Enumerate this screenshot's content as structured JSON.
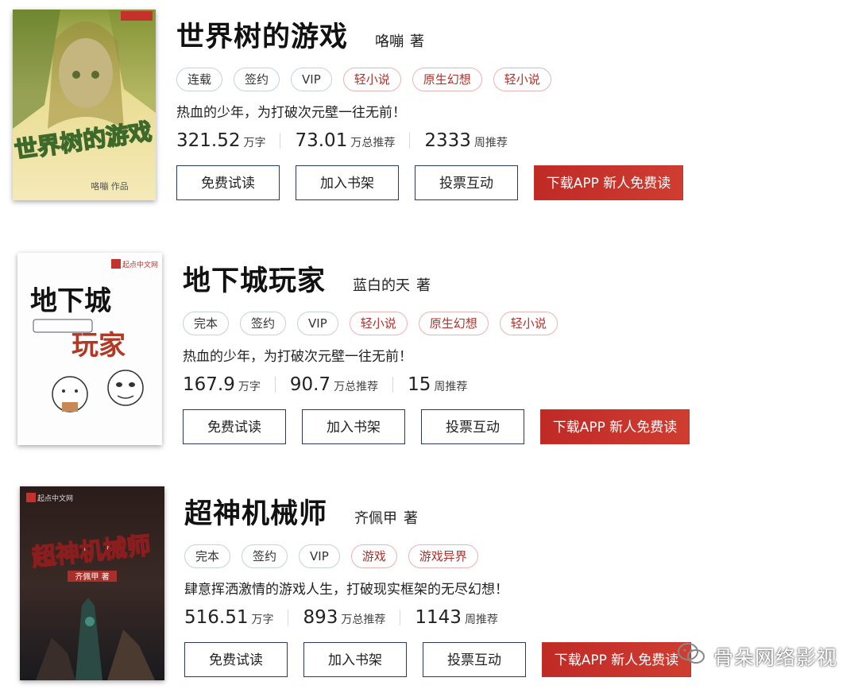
{
  "books": [
    {
      "title": "世界树的游戏",
      "author": "咯嘣",
      "author_suffix": "著",
      "cover_text": "世界树的游戏",
      "cover_author": "咯嘣 作品",
      "tags": [
        {
          "label": "连载",
          "accent": false
        },
        {
          "label": "签约",
          "accent": false
        },
        {
          "label": "VIP",
          "accent": false
        },
        {
          "label": "轻小说",
          "accent": true
        },
        {
          "label": "原生幻想",
          "accent": true
        },
        {
          "label": "轻小说",
          "accent": true
        }
      ],
      "intro": "热血的少年，为打破次元壁一往无前！",
      "stats": [
        {
          "value": "321.52",
          "unit": "万字"
        },
        {
          "value": "73.01",
          "unit": "万总推荐"
        },
        {
          "value": "2333",
          "unit": "周推荐"
        }
      ],
      "buttons": {
        "trial": "免费试读",
        "shelf": "加入书架",
        "vote": "投票互动",
        "download": "下载APP 新人免费读"
      }
    },
    {
      "title": "地下城玩家",
      "author": "蓝白的天",
      "author_suffix": "著",
      "cover_logo": "起点中文网",
      "cover_line1": "地下城",
      "cover_line2": "玩家",
      "tags": [
        {
          "label": "完本",
          "accent": false
        },
        {
          "label": "签约",
          "accent": false
        },
        {
          "label": "VIP",
          "accent": false
        },
        {
          "label": "轻小说",
          "accent": true
        },
        {
          "label": "原生幻想",
          "accent": true
        },
        {
          "label": "轻小说",
          "accent": true
        }
      ],
      "intro": "热血的少年，为打破次元壁一往无前！",
      "stats": [
        {
          "value": "167.9",
          "unit": "万字"
        },
        {
          "value": "90.7",
          "unit": "万总推荐"
        },
        {
          "value": "15",
          "unit": "周推荐"
        }
      ],
      "buttons": {
        "trial": "免费试读",
        "shelf": "加入书架",
        "vote": "投票互动",
        "download": "下载APP 新人免费读"
      }
    },
    {
      "title": "超神机械师",
      "author": "齐佩甲",
      "author_suffix": "著",
      "cover_logo": "起点中文网",
      "cover_text": "超神机械师",
      "cover_author": "齐佩甲 著",
      "tags": [
        {
          "label": "完本",
          "accent": false
        },
        {
          "label": "签约",
          "accent": false
        },
        {
          "label": "VIP",
          "accent": false
        },
        {
          "label": "游戏",
          "accent": true
        },
        {
          "label": "游戏异界",
          "accent": true
        }
      ],
      "intro": "肆意挥洒激情的游戏人生，打破现实框架的无尽幻想！",
      "stats": [
        {
          "value": "516.51",
          "unit": "万字"
        },
        {
          "value": "893",
          "unit": "万总推荐"
        },
        {
          "value": "1143",
          "unit": "周推荐"
        }
      ],
      "buttons": {
        "trial": "免费试读",
        "shelf": "加入书架",
        "vote": "投票互动",
        "download": "下载APP 新人免费读"
      }
    }
  ],
  "watermark": {
    "text": "骨朵网络影视",
    "icon": "wechat-icon"
  }
}
